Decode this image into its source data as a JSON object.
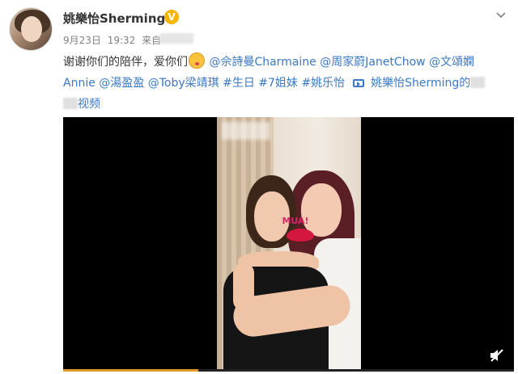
{
  "post": {
    "author": "姚樂怡Sherming",
    "verified_badge": "V",
    "date": "9月23日",
    "time": "19:32",
    "source_prefix": "来自",
    "text": {
      "line1_plain": "谢谢你们的陪伴，爱你们",
      "mention_charmaine": "@佘詩曼Charmaine",
      "mention_janet": "@周家蔚JanetChow",
      "mention_annie_1": "@文頌嫻",
      "mention_annie_2": "Annie",
      "mention_ying": "@湯盈盈",
      "mention_toby": "@Toby梁靖琪",
      "tag_birthday": "#生日",
      "tag_sisters": "#7姐妹",
      "tag_name": "#姚乐怡",
      "video_link": "姚樂怡Sherming的",
      "video_link_end": "视频"
    }
  },
  "video": {
    "progress_fraction": 0.3,
    "sticker_text": "MUA!"
  },
  "colors": {
    "link": "#3a78c3",
    "verify": "#f5b500",
    "progress": "#e39a2a"
  }
}
